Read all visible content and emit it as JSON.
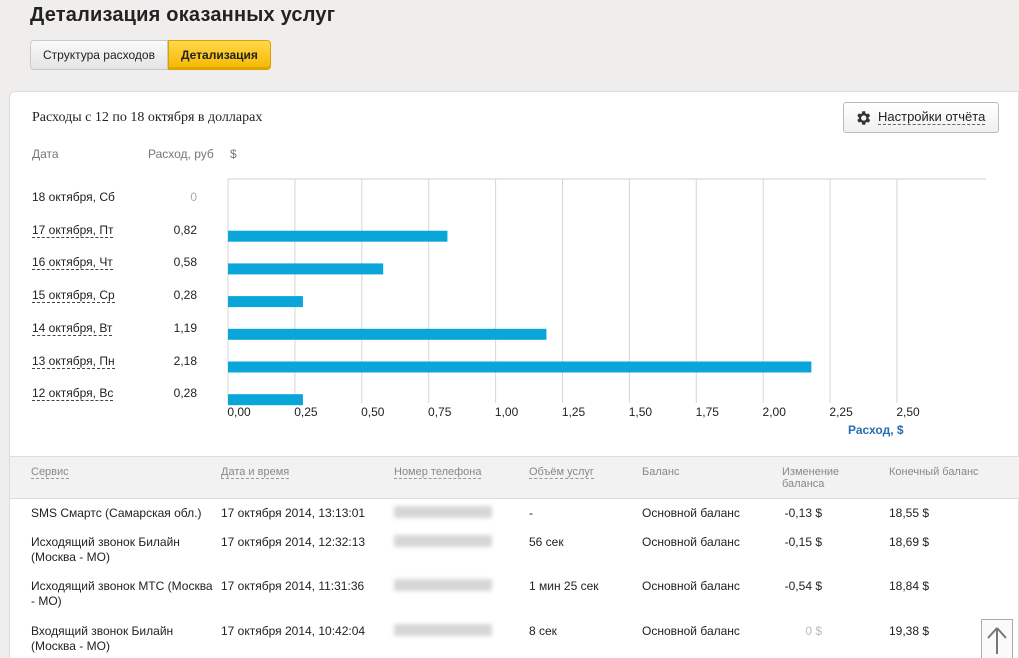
{
  "page_title": "Детализация оказанных услуг",
  "tabs": [
    {
      "label": "Структура расходов"
    },
    {
      "label": "Детализация"
    }
  ],
  "report": {
    "title": "Расходы с 12 по 18 октября в долларах",
    "settings_label": "Настройки отчёта",
    "col_date": "Дата",
    "col_expense": "Расход, руб",
    "col_currency": "$"
  },
  "chart_data": {
    "type": "bar",
    "orientation": "horizontal",
    "categories": [
      "18 октября, Сб",
      "17 октября, Пт",
      "16 октября, Чт",
      "15 октября, Ср",
      "14 октября, Вт",
      "13 октября, Пн",
      "12 октября, Вс"
    ],
    "value_labels": [
      "0",
      "0,82",
      "0,58",
      "0,28",
      "1,19",
      "2,18",
      "0,28"
    ],
    "values": [
      0,
      0.82,
      0.58,
      0.28,
      1.19,
      2.18,
      0.28
    ],
    "xlim": [
      0,
      2.5
    ],
    "xticks": [
      "0,00",
      "0,25",
      "0,50",
      "0,75",
      "1,00",
      "1,25",
      "1,50",
      "1,75",
      "2,00",
      "2,25",
      "2,50"
    ],
    "xlabel": "Расход, $",
    "bar_color": "#0aa5d9",
    "grid": true
  },
  "table": {
    "headers": {
      "service": "Сервис",
      "datetime": "Дата и время",
      "phone": "Номер телефона",
      "volume": "Объём услуг",
      "balance": "Баланс",
      "change": "Изменение баланса",
      "final": "Конечный баланс"
    },
    "rows": [
      {
        "service": "SMS Смартс (Самарская обл.)",
        "datetime": "17 октября 2014, 13:13:01",
        "volume": "-",
        "balance": "Основной баланс",
        "change": "-0,13 $",
        "final": "18,55 $"
      },
      {
        "service": "Исходящий звонок Билайн (Москва - МО)",
        "datetime": "17 октября 2014, 12:32:13",
        "volume": "56 сек",
        "balance": "Основной баланс",
        "change": "-0,15 $",
        "final": "18,69 $"
      },
      {
        "service": "Исходящий звонок МТС (Москва - МО)",
        "datetime": "17 октября 2014, 11:31:36",
        "volume": "1 мин 25 сек",
        "balance": "Основной баланс",
        "change": "-0,54 $",
        "final": "18,84 $"
      },
      {
        "service": "Входящий звонок Билайн (Москва - МО)",
        "datetime": "17 октября 2014, 10:42:04",
        "volume": "8 сек",
        "balance": "Основной баланс",
        "change": "0 $",
        "final": "19,38 $"
      }
    ]
  },
  "icons": {
    "settings": "gear-icon",
    "scroll_top": "arrow-up-icon"
  }
}
